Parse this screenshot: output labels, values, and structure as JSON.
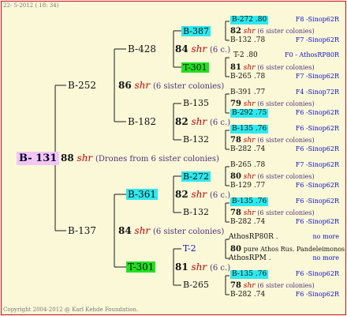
{
  "header": {
    "date": "22-  5-2012 ( 18: 34)"
  },
  "footer": {
    "copyright": "Copyright 2004-2012 @ Karl Kehde Foundation."
  },
  "colors": {
    "background": "#fbf8d8",
    "highlight_cyan": "#2ee8ee",
    "highlight_green": "#22e022",
    "drone_tag": "#c00000",
    "source": "#1010c0",
    "root_highlight": "#f3c7f3"
  },
  "root": {
    "label": "B- 131",
    "num": "88",
    "tag": "shr",
    "note": "(Drones from 6 sister colonies)"
  },
  "gen1": [
    {
      "label": "B-252",
      "num": "86",
      "tag": "shr",
      "note": "(6 sister colonies)"
    },
    {
      "label": "B-137",
      "num": "84",
      "tag": "shr",
      "note": "(6 sister colonies)"
    }
  ],
  "gen2": [
    {
      "label": "B-428",
      "num": "84",
      "tag": "shr",
      "note": "(6 c.)"
    },
    {
      "label": "B-182",
      "num": "82",
      "tag": "shr",
      "note": "(6 c.)"
    },
    {
      "label": "B-361",
      "num": "82",
      "tag": "shr",
      "note": "(6 c.)"
    },
    {
      "label": "T-301",
      "num": "81",
      "tag": "shr",
      "note": "(6 c.)"
    }
  ],
  "gen3": [
    {
      "label": "B-387",
      "num": "82",
      "tag": "shr",
      "note": "(6 sister colonies)"
    },
    {
      "label": "T-301",
      "num": "81",
      "tag": "shr",
      "note": "(6 sister colonies)"
    },
    {
      "label": "B-135",
      "num": "79",
      "tag": "shr",
      "note": "(6 sister colonies)"
    },
    {
      "label": "B-132",
      "num": "78",
      "tag": "shr",
      "note": "(6 sister colonies)"
    },
    {
      "label": "B-272",
      "num": "80",
      "tag": "shr",
      "note": "(6 sister colonies)"
    },
    {
      "label": "B-132",
      "num": "78",
      "tag": "shr",
      "note": "(6 sister colonies)"
    },
    {
      "label": "T-2",
      "num": "80",
      "tag": "",
      "note": "pure Athos Rus. Pandeleimonos"
    },
    {
      "label": "B-265",
      "num": "78",
      "tag": "shr",
      "note": "(6 sister colonies)"
    }
  ],
  "gen4": [
    {
      "label": "B-272 .80",
      "src": "F8 -Sinop62R"
    },
    {
      "label": "B-132 .78",
      "src": "F7 -Sinop62R"
    },
    {
      "label": "T-2 .80",
      "src": "F0 - AthosRP80R"
    },
    {
      "label": "B-265 .78",
      "src": "F7 -Sinop62R"
    },
    {
      "label": "B-391 .77",
      "src": "F4 -Sinop72R"
    },
    {
      "label": "B-292 .75",
      "src": "F6 -Sinop62R"
    },
    {
      "label": "B-135 .76",
      "src": "F6 -Sinop62R"
    },
    {
      "label": "B-282 .74",
      "src": "F6 -Sinop62R"
    },
    {
      "label": "B-265 .78",
      "src": "F7 -Sinop62R"
    },
    {
      "label": "B-129 .77",
      "src": "F6 -Sinop62R"
    },
    {
      "label": "B-135 .76",
      "src": "F6 -Sinop62R"
    },
    {
      "label": "B-282 .74",
      "src": "F6 -Sinop62R"
    },
    {
      "label": "AthosRP80R .",
      "src": "no more"
    },
    {
      "label": "AthosRPM .",
      "src": "no more"
    },
    {
      "label": "B-135 .76",
      "src": "F6 -Sinop62R"
    },
    {
      "label": "B-282 .74",
      "src": "F6 -Sinop62R"
    }
  ]
}
